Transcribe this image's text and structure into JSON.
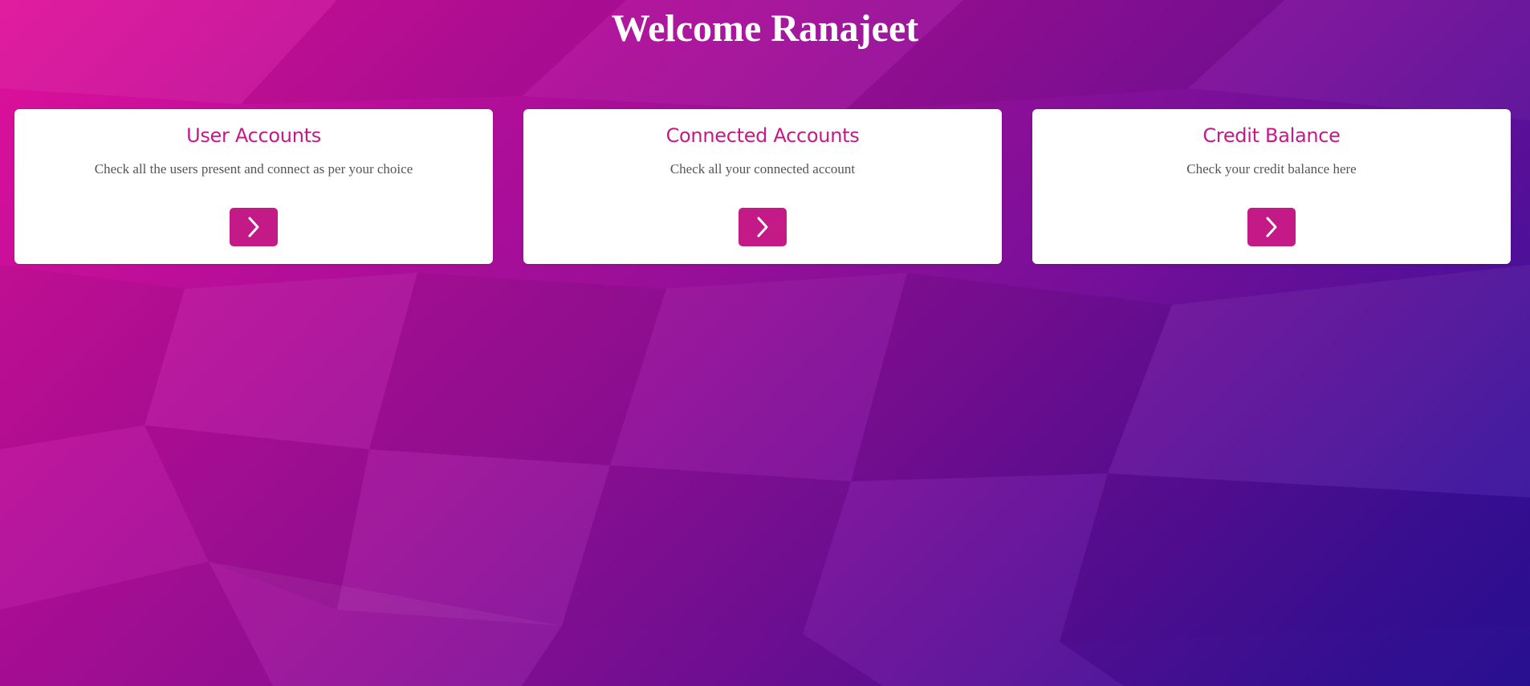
{
  "header": {
    "title": "Welcome Ranajeet"
  },
  "cards": [
    {
      "title": "User Accounts",
      "description": "Check all the users present and connect as per your choice",
      "button_icon": "chevron-right-icon"
    },
    {
      "title": "Connected Accounts",
      "description": "Check all your connected account",
      "button_icon": "chevron-right-icon"
    },
    {
      "title": "Credit Balance",
      "description": "Check your credit balance here",
      "button_icon": "chevron-right-icon"
    }
  ],
  "theme": {
    "accent": "#c31a87",
    "background_start": "#e0109a",
    "background_end": "#2a1199",
    "card_background": "#ffffff",
    "description_text": "#555555",
    "title_text": "#ffffff"
  }
}
